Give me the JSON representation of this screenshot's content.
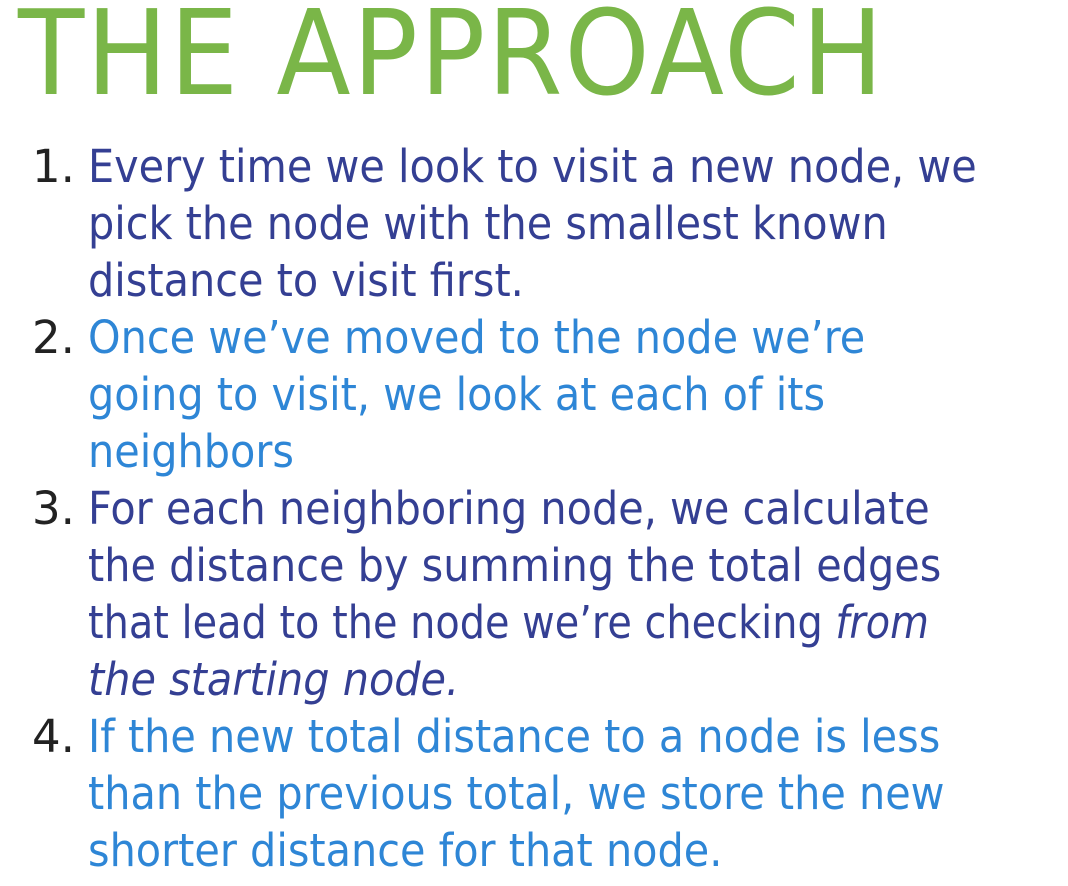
{
  "slide": {
    "title": "THE APPROACH",
    "title_color": "#7ab648",
    "number_color": "#222222",
    "dark_text_color": "#343f93",
    "light_text_color": "#2e86d6",
    "items": [
      {
        "number": "1.",
        "lines": [
          "Every time we look to visit a new node, we",
          "pick the node with the smallest known",
          "distance to visit first."
        ]
      },
      {
        "number": "2.",
        "lines": [
          "Once we’ve moved to the node we’re",
          "going to visit, we look at each of its",
          "neighbors"
        ]
      },
      {
        "number": "3.",
        "lines": [
          "For each neighboring node, we calculate",
          "the distance by summing the total edges",
          "that lead to the node we’re checking ",
          "the starting node."
        ],
        "emphasis_line3": "from"
      },
      {
        "number": "4.",
        "lines": [
          "If the new total distance to a node is less",
          "than the previous total, we store the new",
          "shorter distance for that node."
        ]
      }
    ]
  }
}
